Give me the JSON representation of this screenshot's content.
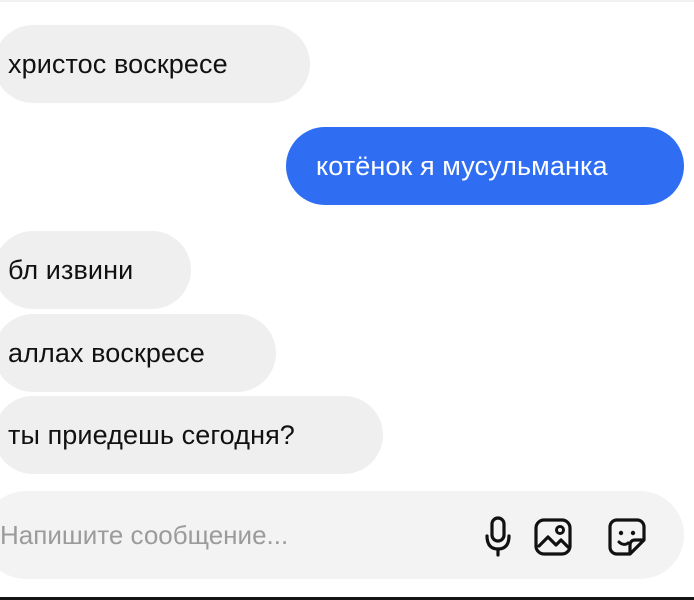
{
  "messages": [
    {
      "side": "incoming",
      "text": "христос воскресе"
    },
    {
      "side": "outgoing",
      "text": "котёнок я мусульманка"
    },
    {
      "side": "incoming",
      "text": "бл извини"
    },
    {
      "side": "incoming",
      "text": "аллах воскресе"
    },
    {
      "side": "incoming",
      "text": "ты приедешь сегодня?"
    }
  ],
  "composer": {
    "placeholder": "Напишите сообщение..."
  },
  "icons": {
    "microphone": "microphone-icon",
    "gallery": "image-gallery-icon",
    "sticker": "sticker-icon"
  },
  "colors": {
    "incoming_bubble": "#efefef",
    "outgoing_bubble": "#2f6ef3",
    "outgoing_text": "#ffffff",
    "composer_background": "#f3f3f3"
  }
}
